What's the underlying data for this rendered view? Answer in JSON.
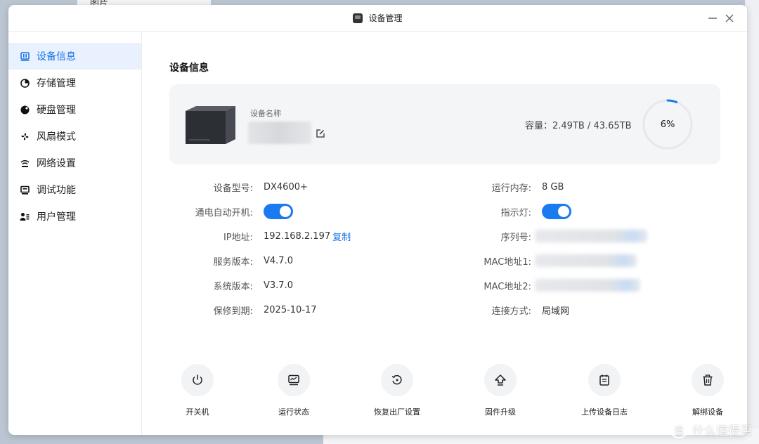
{
  "background": {
    "label": "图片"
  },
  "window": {
    "title": "设备管理"
  },
  "sidebar": {
    "items": [
      {
        "label": "设备信息",
        "icon": "device-info-icon",
        "active": true
      },
      {
        "label": "存储管理",
        "icon": "pie-icon"
      },
      {
        "label": "硬盘管理",
        "icon": "disk-icon"
      },
      {
        "label": "风扇模式",
        "icon": "fan-icon"
      },
      {
        "label": "网络设置",
        "icon": "wifi-icon"
      },
      {
        "label": "调试功能",
        "icon": "monitor-icon"
      },
      {
        "label": "用户管理",
        "icon": "users-icon"
      }
    ]
  },
  "main": {
    "section_title": "设备信息",
    "device_name_label": "设备名称",
    "capacity": "容量：2.49TB / 43.65TB",
    "usage_percent": "6%",
    "usage_fraction": 0.06,
    "info_left": [
      {
        "label": "设备型号:",
        "value": "DX4600+"
      },
      {
        "label": "通电自动开机:",
        "value": "",
        "toggle": true
      },
      {
        "label": "IP地址:",
        "value": "192.168.2.197",
        "link": "复制"
      },
      {
        "label": "服务版本:",
        "value": "V4.7.0"
      },
      {
        "label": "系统版本:",
        "value": "V3.7.0"
      },
      {
        "label": "保修到期:",
        "value": "2025-10-17"
      }
    ],
    "info_right": [
      {
        "label": "运行内存:",
        "value": "8 GB"
      },
      {
        "label": "指示灯:",
        "value": "",
        "toggle": true
      },
      {
        "label": "序列号:",
        "value": ""
      },
      {
        "label": "MAC地址1:",
        "value": ""
      },
      {
        "label": "MAC地址2:",
        "value": ""
      },
      {
        "label": "连接方式:",
        "value": "局域网"
      }
    ],
    "actions": [
      {
        "label": "开关机",
        "icon": "power-icon"
      },
      {
        "label": "运行状态",
        "icon": "status-icon"
      },
      {
        "label": "恢复出厂设置",
        "icon": "reset-icon"
      },
      {
        "label": "固件升级",
        "icon": "upgrade-icon"
      },
      {
        "label": "上传设备日志",
        "icon": "log-icon"
      },
      {
        "label": "解绑设备",
        "icon": "trash-icon"
      }
    ]
  },
  "watermark": {
    "text": "什么值得买",
    "badge": "值"
  },
  "colors": {
    "accent": "#1a73e8",
    "toggle_on": "#1a7bf0"
  }
}
